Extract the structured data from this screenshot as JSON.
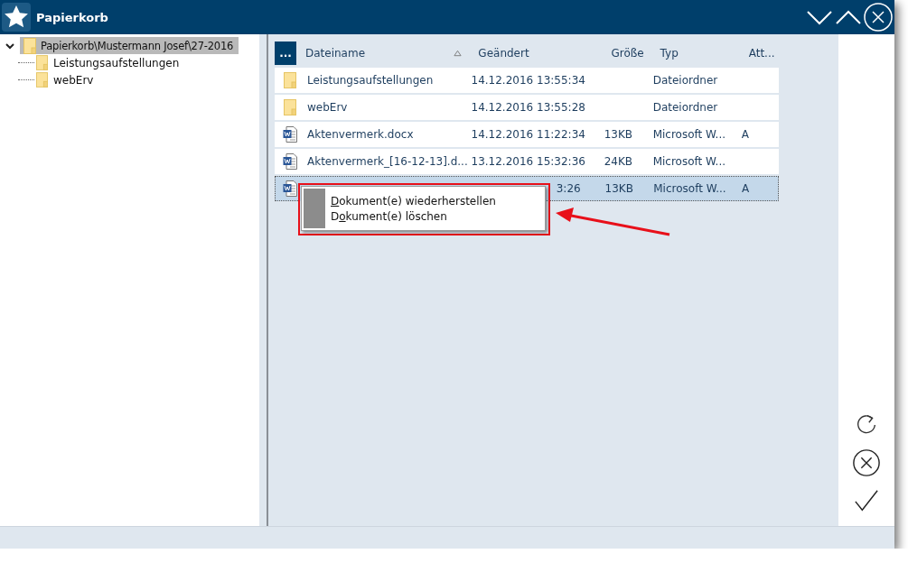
{
  "window": {
    "title": "Papierkorb"
  },
  "tree": {
    "label": "Papierkorb\\Mustermann Josef\\27-2016",
    "expanded": true,
    "selected": true,
    "children": [
      {
        "label": "Leistungsaufstellungen",
        "selected": false
      },
      {
        "label": "webErv",
        "selected": false
      }
    ]
  },
  "table": {
    "menu_button": "...",
    "columns": [
      {
        "label": "Dateiname",
        "sorted": true
      },
      {
        "label": "Geändert",
        "sorted": false
      },
      {
        "label": "Größe",
        "sorted": false
      },
      {
        "label": "Typ",
        "sorted": false
      },
      {
        "label": "Att...",
        "sorted": false
      }
    ],
    "rows": [
      {
        "kind": "folder",
        "selected": false,
        "name": "Leistungsaufstellungen",
        "modified": "14.12.2016 13:55:34",
        "type": "Dateiordner"
      },
      {
        "kind": "folder",
        "selected": false,
        "name": "webErv",
        "modified": "14.12.2016 13:55:28",
        "type": "Dateiordner"
      },
      {
        "kind": "word",
        "selected": false,
        "name": "Aktenvermerk.docx",
        "modified": "14.12.2016 11:22:34",
        "size": "13KB",
        "type": "Microsoft W...",
        "attributes": "A"
      },
      {
        "kind": "word",
        "selected": false,
        "name": "Aktenvermerk_[16-12-13].d...",
        "modified": "13.12.2016 15:32:36",
        "size": "24KB",
        "type": "Microsoft W..."
      },
      {
        "kind": "word",
        "selected": true,
        "modified": "3:26",
        "size": "13KB",
        "type": "Microsoft W...",
        "attributes": "A"
      }
    ]
  },
  "context_menu": {
    "items": [
      {
        "mnemonic": "D",
        "rest": "okument(e) wiederherstellen"
      },
      {
        "before": "D",
        "mnemonic": "o",
        "rest": "kument(e) löschen"
      }
    ]
  }
}
